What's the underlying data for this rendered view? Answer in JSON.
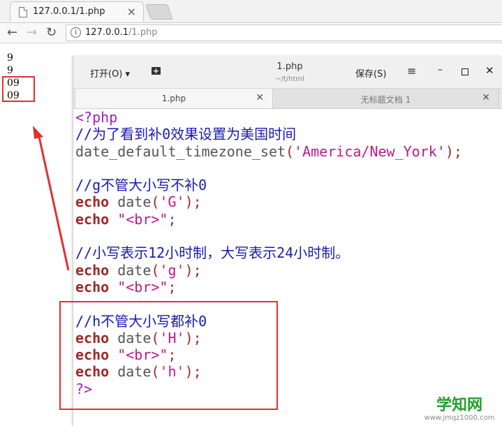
{
  "browser": {
    "tab_title": "127.0.0.1/1.php",
    "close_glyph": "×",
    "url_host": "127.0.0.1",
    "url_path": "/1.php",
    "info_glyph": "i",
    "back_glyph": "←",
    "forward_glyph": "→",
    "reload_glyph": "↻"
  },
  "output": [
    "9",
    "9",
    "09",
    "09"
  ],
  "editor": {
    "open_label": "打开(O) ▾",
    "file_title": "1.php",
    "file_path": "~/t/html",
    "save_label": "保存(S)",
    "menu_glyph": "≡",
    "min_glyph": "–",
    "close_glyph": "✕",
    "tabs": [
      {
        "label": "1.php",
        "close": "✕"
      },
      {
        "label": "无标题文档 1",
        "close": "✕"
      }
    ],
    "code": [
      [
        {
          "t": "<?php",
          "c": "tag"
        }
      ],
      [
        {
          "t": "//为了看到补0效果设置为美国时间",
          "c": "com"
        }
      ],
      [
        {
          "t": "date_default_timezone_set",
          "c": "fn"
        },
        {
          "t": "(",
          "c": "par"
        },
        {
          "t": "'America/New_York'",
          "c": "str"
        },
        {
          "t": ");",
          "c": "par"
        }
      ],
      [],
      [
        {
          "t": "//g不管大小写不补0",
          "c": "com"
        }
      ],
      [
        {
          "t": "echo",
          "c": "kw"
        },
        {
          "t": " date",
          "c": "fn"
        },
        {
          "t": "(",
          "c": "par"
        },
        {
          "t": "'G'",
          "c": "str"
        },
        {
          "t": ");",
          "c": "par"
        }
      ],
      [
        {
          "t": "echo",
          "c": "kw"
        },
        {
          "t": " ",
          "c": "fn"
        },
        {
          "t": "\"<br>\"",
          "c": "str"
        },
        {
          "t": ";",
          "c": "par"
        }
      ],
      [],
      [
        {
          "t": "//小写表示12小时制，大写表示24小时制。",
          "c": "com"
        }
      ],
      [
        {
          "t": "echo",
          "c": "kw"
        },
        {
          "t": " date",
          "c": "fn"
        },
        {
          "t": "(",
          "c": "par"
        },
        {
          "t": "'g'",
          "c": "str"
        },
        {
          "t": ");",
          "c": "par"
        }
      ],
      [
        {
          "t": "echo",
          "c": "kw"
        },
        {
          "t": " ",
          "c": "fn"
        },
        {
          "t": "\"<br>\"",
          "c": "str"
        },
        {
          "t": ";",
          "c": "par"
        }
      ],
      [],
      [
        {
          "t": "//h不管大小写都补0",
          "c": "com"
        }
      ],
      [
        {
          "t": "echo",
          "c": "kw"
        },
        {
          "t": " date",
          "c": "fn"
        },
        {
          "t": "(",
          "c": "par"
        },
        {
          "t": "'H'",
          "c": "str"
        },
        {
          "t": ");",
          "c": "par"
        }
      ],
      [
        {
          "t": "echo",
          "c": "kw"
        },
        {
          "t": " ",
          "c": "fn"
        },
        {
          "t": "\"<br>\"",
          "c": "str"
        },
        {
          "t": ";",
          "c": "par"
        }
      ],
      [
        {
          "t": "echo",
          "c": "kw"
        },
        {
          "t": " date",
          "c": "fn"
        },
        {
          "t": "(",
          "c": "par"
        },
        {
          "t": "'h'",
          "c": "str"
        },
        {
          "t": ");",
          "c": "par"
        }
      ],
      [
        {
          "t": "?>",
          "c": "tag"
        }
      ]
    ]
  },
  "watermark": {
    "cn": "学知网",
    "url": "www.jmqz1000.com"
  },
  "colors": {
    "annotation_red": "#e03030",
    "php_tag": "#a020c0",
    "comment": "#1a1ab0",
    "keyword": "#a02828",
    "string": "#c01888",
    "watermark_green": "#22a02a"
  }
}
